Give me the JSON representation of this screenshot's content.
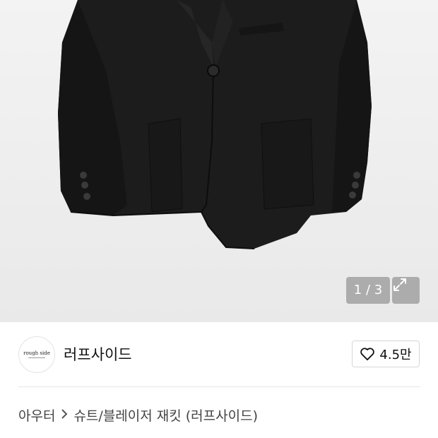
{
  "gallery": {
    "page_indicator": "1 / 3",
    "expand_icon": "expand-arrows-icon",
    "background": "#efefef",
    "product_color": "#1c1c1c"
  },
  "brand": {
    "logo_text": "rough side",
    "name": "러프사이드"
  },
  "like": {
    "icon": "heart-outline-icon",
    "count": "4.5만"
  },
  "breadcrumb": {
    "category": "아우터",
    "separator_icon": "chevron-right-icon",
    "subcategory": "슈트/블레이저 재킷 (러프사이드)"
  }
}
